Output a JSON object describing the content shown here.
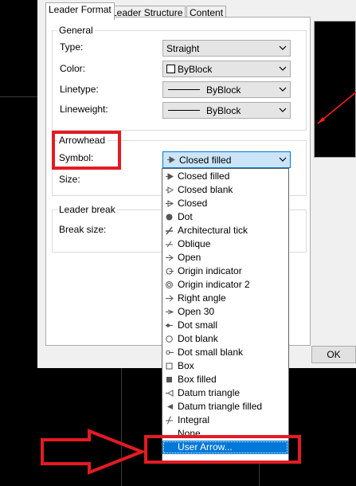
{
  "tabs": [
    "Leader Format",
    "Leader Structure",
    "Content"
  ],
  "general": {
    "title": "General",
    "type_label": "Type:",
    "type_value": "Straight",
    "color_label": "Color:",
    "color_value": "ByBlock",
    "linetype_label": "Linetype:",
    "linetype_value": "ByBlock",
    "lineweight_label": "Lineweight:",
    "lineweight_value": "ByBlock"
  },
  "arrowhead": {
    "title": "Arrowhead",
    "symbol_label": "Symbol:",
    "symbol_value": "Closed filled",
    "size_label": "Size:"
  },
  "leader_break": {
    "title": "Leader break",
    "break_size_label": "Break size:"
  },
  "ok_label": "OK",
  "dropdown": {
    "items": [
      {
        "label": "Closed filled",
        "icon": "closed-filled-icon"
      },
      {
        "label": "Closed blank",
        "icon": "closed-blank-icon"
      },
      {
        "label": "Closed",
        "icon": "closed-icon"
      },
      {
        "label": "Dot",
        "icon": "dot-icon"
      },
      {
        "label": "Architectural tick",
        "icon": "architectural-tick-icon"
      },
      {
        "label": "Oblique",
        "icon": "oblique-icon"
      },
      {
        "label": "Open",
        "icon": "open-icon"
      },
      {
        "label": "Origin indicator",
        "icon": "origin-indicator-icon"
      },
      {
        "label": "Origin indicator 2",
        "icon": "origin-indicator-2-icon"
      },
      {
        "label": "Right angle",
        "icon": "right-angle-icon"
      },
      {
        "label": "Open 30",
        "icon": "open-30-icon"
      },
      {
        "label": "Dot small",
        "icon": "dot-small-icon"
      },
      {
        "label": "Dot blank",
        "icon": "dot-blank-icon"
      },
      {
        "label": "Dot small blank",
        "icon": "dot-small-blank-icon"
      },
      {
        "label": "Box",
        "icon": "box-icon"
      },
      {
        "label": "Box filled",
        "icon": "box-filled-icon"
      },
      {
        "label": "Datum triangle",
        "icon": "datum-triangle-icon"
      },
      {
        "label": "Datum triangle filled",
        "icon": "datum-triangle-filled-icon"
      },
      {
        "label": "Integral",
        "icon": "integral-icon"
      },
      {
        "label": "None",
        "icon": ""
      },
      {
        "label": "User Arrow...",
        "icon": ""
      }
    ],
    "selected_index": 20
  },
  "colors": {
    "highlight": "#e31b23",
    "selection": "#0078d7"
  }
}
